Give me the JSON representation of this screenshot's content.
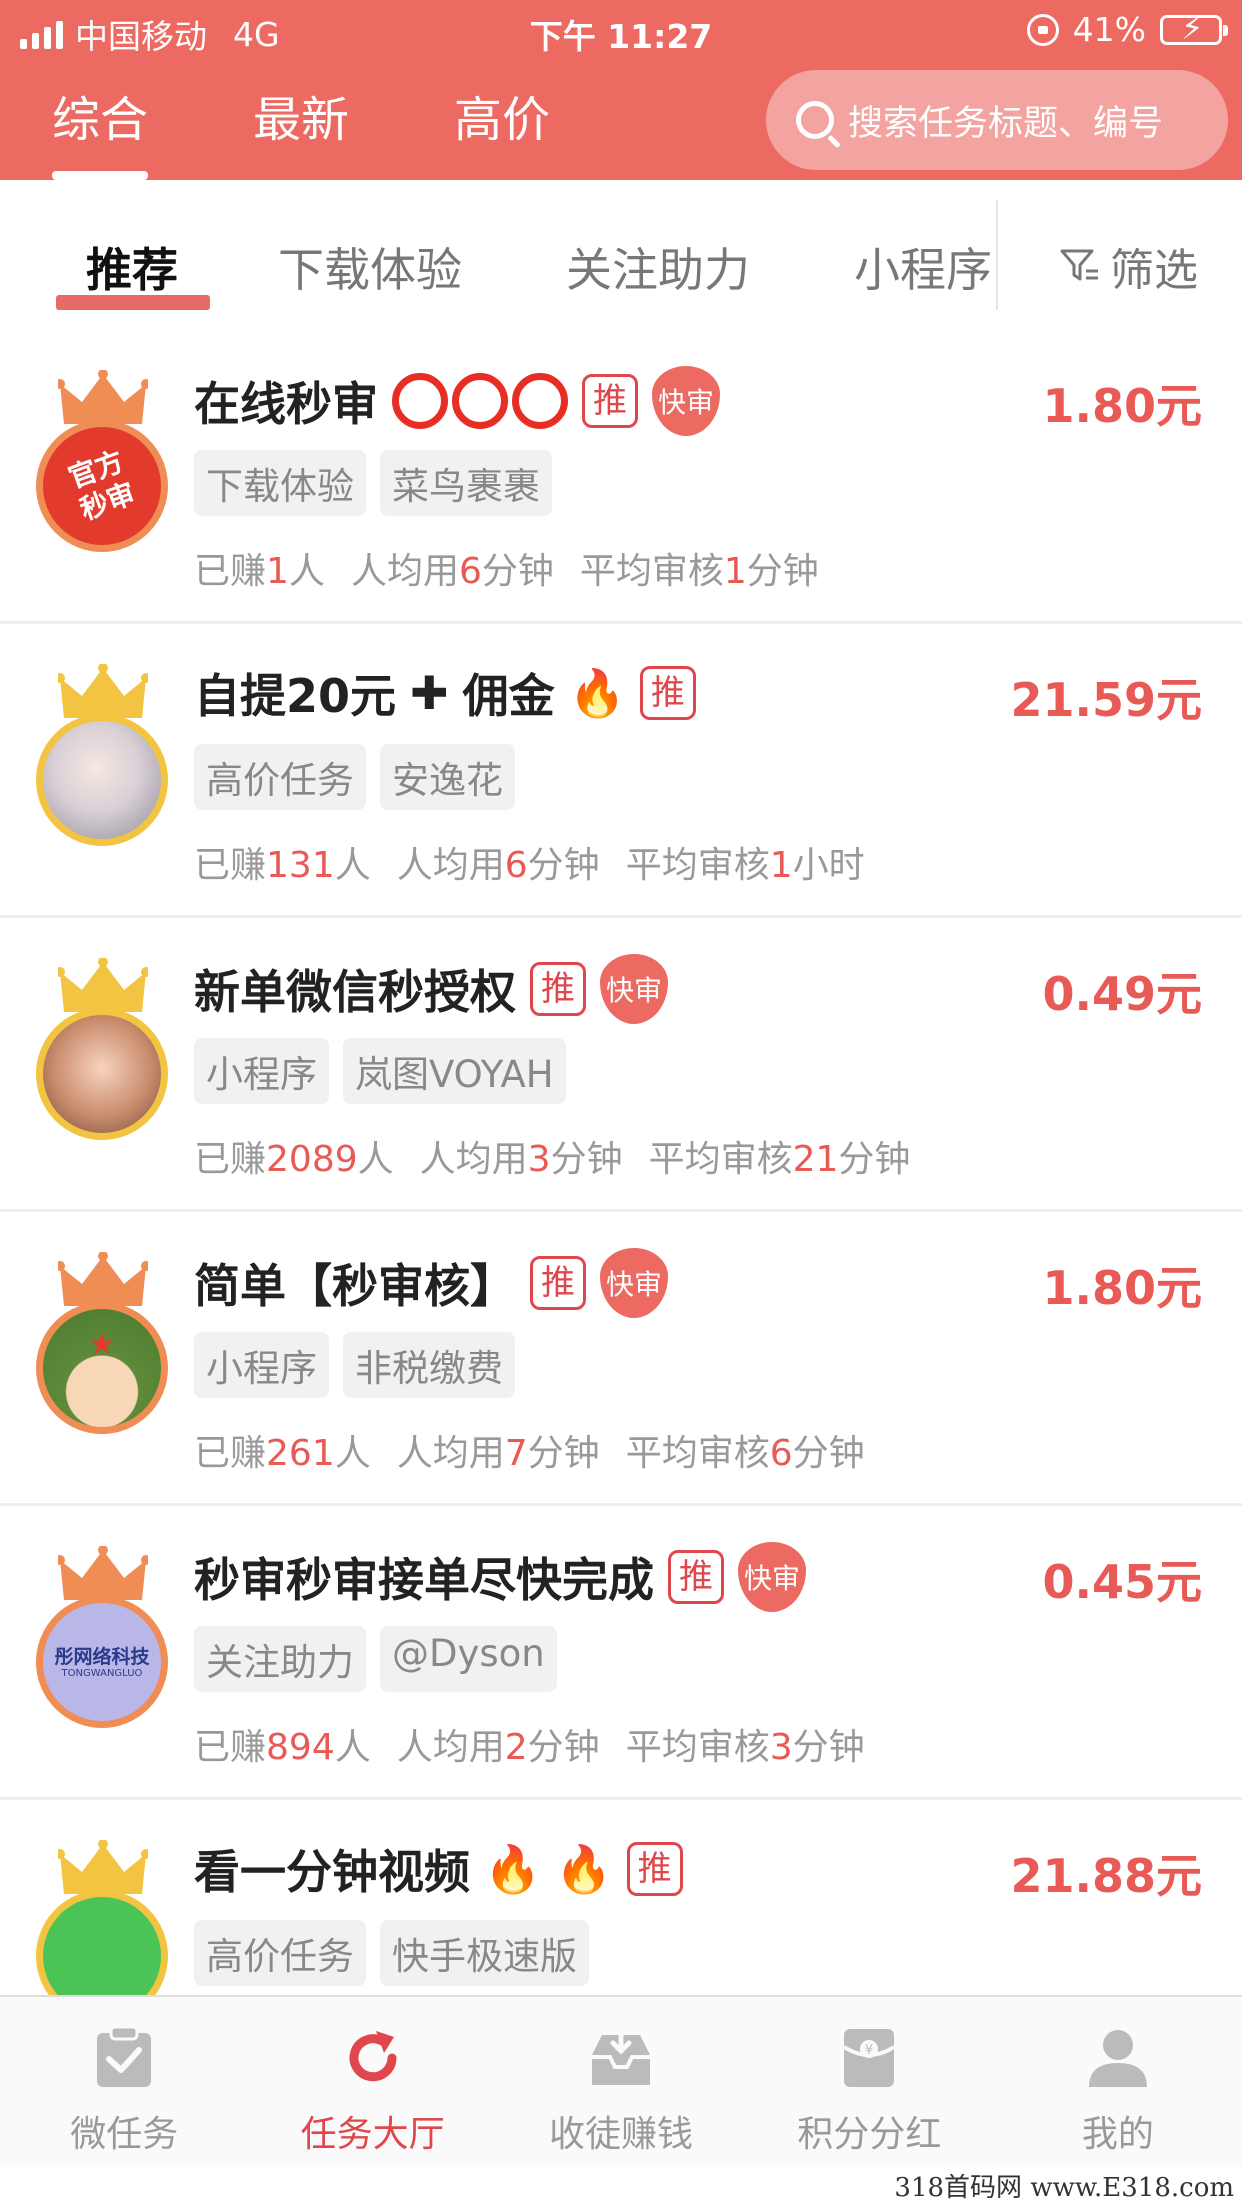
{
  "status_bar": {
    "carrier": "中国移动",
    "network": "4G",
    "time": "下午 11:27",
    "battery": "41%"
  },
  "top_tabs": [
    {
      "label": "综合"
    },
    {
      "label": "最新"
    },
    {
      "label": "高价"
    }
  ],
  "search": {
    "placeholder": "搜索任务标题、编号"
  },
  "categories": [
    {
      "label": "推荐"
    },
    {
      "label": "下载体验"
    },
    {
      "label": "关注助力"
    },
    {
      "label": "小程序"
    }
  ],
  "filter_label": "筛选",
  "tasks": [
    {
      "title": "在线秒审",
      "badge_tui": "推",
      "badge_kuai": "快审",
      "price": "1.80元",
      "tags": [
        "下载体验",
        "菜鸟裹裹"
      ],
      "avatar_text": "官方秒审",
      "stats": {
        "earned_pre": "已赚",
        "earned": "1",
        "earned_post": "人",
        "avg_pre": "人均用",
        "avg": "6",
        "avg_post": "分钟",
        "review_pre": "平均审核",
        "review": "1",
        "review_post": "分钟"
      }
    },
    {
      "title": "自提20元",
      "title_suffix": "佣金",
      "badge_tui": "推",
      "price": "21.59元",
      "tags": [
        "高价任务",
        "安逸花"
      ],
      "stats": {
        "earned_pre": "已赚",
        "earned": "131",
        "earned_post": "人",
        "avg_pre": "人均用",
        "avg": "6",
        "avg_post": "分钟",
        "review_pre": "平均审核",
        "review": "1",
        "review_post": "小时"
      }
    },
    {
      "title": "新单微信秒授权",
      "badge_tui": "推",
      "badge_kuai": "快审",
      "price": "0.49元",
      "tags": [
        "小程序",
        "岚图VOYAH"
      ],
      "stats": {
        "earned_pre": "已赚",
        "earned": "2089",
        "earned_post": "人",
        "avg_pre": "人均用",
        "avg": "3",
        "avg_post": "分钟",
        "review_pre": "平均审核",
        "review": "21",
        "review_post": "分钟"
      }
    },
    {
      "title": "简单【秒审核】",
      "badge_tui": "推",
      "badge_kuai": "快审",
      "price": "1.80元",
      "tags": [
        "小程序",
        "非税缴费"
      ],
      "stats": {
        "earned_pre": "已赚",
        "earned": "261",
        "earned_post": "人",
        "avg_pre": "人均用",
        "avg": "7",
        "avg_post": "分钟",
        "review_pre": "平均审核",
        "review": "6",
        "review_post": "分钟"
      }
    },
    {
      "title": "秒审秒审接单尽快完成",
      "badge_tui": "推",
      "badge_kuai": "快审",
      "price": "0.45元",
      "tags": [
        "关注助力",
        "@Dyson"
      ],
      "avatar_text": "彤网络科技",
      "avatar_subtext": "TONGWANGLUO",
      "stats": {
        "earned_pre": "已赚",
        "earned": "894",
        "earned_post": "人",
        "avg_pre": "人均用",
        "avg": "2",
        "avg_post": "分钟",
        "review_pre": "平均审核",
        "review": "3",
        "review_post": "分钟"
      }
    },
    {
      "title": "看一分钟视频",
      "badge_tui": "推",
      "price": "21.88元",
      "tags": [
        "高价任务",
        "快手极速版"
      ]
    }
  ],
  "bottom_nav": [
    {
      "label": "微任务"
    },
    {
      "label": "任务大厅"
    },
    {
      "label": "收徒赚钱"
    },
    {
      "label": "积分分红"
    },
    {
      "label": "我的"
    }
  ],
  "watermark": "318首码网 www.E318.com",
  "colors": {
    "header": "#ec6a62",
    "accent": "#e85a55",
    "active_nav": "#e0474d",
    "crown_gold": "#f3c441",
    "crown_orange": "#f08d55"
  }
}
